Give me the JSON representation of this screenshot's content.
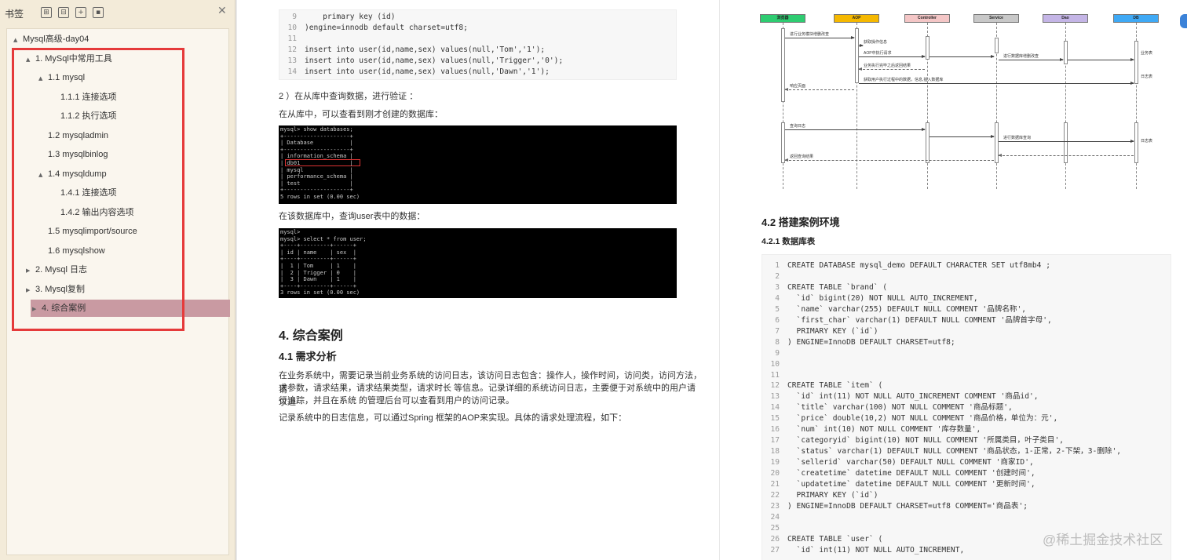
{
  "sidebar": {
    "title": "书签",
    "toolbar_icons": [
      "expand-all-icon",
      "collapse-all-icon",
      "add-bookmark-icon",
      "bookmark-icon"
    ],
    "toc": [
      {
        "label": "Mysql高级-day04",
        "level": 0,
        "twisty": "▲"
      },
      {
        "label": "1. MySql中常用工具",
        "level": 1,
        "twisty": "▲"
      },
      {
        "label": "1.1 mysql",
        "level": 2,
        "twisty": "▲"
      },
      {
        "label": "1.1.1 连接选项",
        "level": 3,
        "twisty": ""
      },
      {
        "label": "1.1.2 执行选项",
        "level": 3,
        "twisty": ""
      },
      {
        "label": "1.2 mysqladmin",
        "level": 2,
        "twisty": ""
      },
      {
        "label": "1.3 mysqlbinlog",
        "level": 2,
        "twisty": ""
      },
      {
        "label": "1.4 mysqldump",
        "level": 2,
        "twisty": "▲"
      },
      {
        "label": "1.4.1 连接选项",
        "level": 3,
        "twisty": ""
      },
      {
        "label": "1.4.2 输出内容选项",
        "level": 3,
        "twisty": ""
      },
      {
        "label": "1.5 mysqlimport/source",
        "level": 2,
        "twisty": ""
      },
      {
        "label": "1.6 mysqlshow",
        "level": 2,
        "twisty": ""
      },
      {
        "label": "2. Mysql 日志",
        "level": 1,
        "twisty": "▶"
      },
      {
        "label": "3. Mysql复制",
        "level": 1,
        "twisty": "▶"
      },
      {
        "label": "4. 综合案例",
        "level": 1,
        "twisty": "▶",
        "active": true
      }
    ]
  },
  "page1": {
    "code_top": [
      {
        "n": "9",
        "t": "    primary key (id)"
      },
      {
        "n": "10",
        "t": ")engine=innodb default charset=utf8;"
      },
      {
        "n": "11",
        "t": ""
      },
      {
        "n": "12",
        "t": "insert into user(id,name,sex) values(null,'Tom','1');"
      },
      {
        "n": "13",
        "t": "insert into user(id,name,sex) values(null,'Trigger','0');"
      },
      {
        "n": "14",
        "t": "insert into user(id,name,sex) values(null,'Dawn','1');"
      }
    ],
    "step2": "2 ）在从库中查询数据，进行验证 ：",
    "step2_desc": "在从库中，可以查看到刚才创建的数据库：",
    "term1": [
      "mysql> show databases;",
      "+--------------------+",
      "| Database           |",
      "+--------------------+",
      "| information_schema |",
      "| db01               |",
      "| mysql              |",
      "| performance_schema |",
      "| test               |",
      "+--------------------+",
      "5 rows in set (0.00 sec)"
    ],
    "term2_desc": "在该数据库中，查询user表中的数据：",
    "term2": [
      "mysql>",
      "mysql> select * from user;",
      "+----+---------+------+",
      "| id | name    | sex  |",
      "+----+---------+------+",
      "|  1 | Tom     | 1    |",
      "|  2 | Trigger | 0    |",
      "|  3 | Dawn    | 1    |",
      "+----+---------+------+",
      "3 rows in set (0.00 sec)"
    ],
    "h2": "4. 综合案例",
    "h3": "4.1 需求分析",
    "para1_lines": [
      "在业务系统中，需要记录当前业务系统的访问日志，该访问日志包含：操作人，操作时间，访问类，访问方法，请",
      "求参数，请求结果，请求结果类型，请求时长 等信息。记录详细的系统访问日志，主要便于对系统中的用户请求进",
      "行追踪，并且在系统 的管理后台可以查看到用户的访问记录。"
    ],
    "para2": "记录系统中的日志信息，可以通过Spring 框架的AOP来实现。具体的请求处理流程，如下："
  },
  "page2": {
    "seq": {
      "heads": [
        {
          "label": "浏览器",
          "color": "#2ecc71"
        },
        {
          "label": "AOP",
          "color": "#f5b800"
        },
        {
          "label": "Controller",
          "color": "#f4c6c6"
        },
        {
          "label": "Service",
          "color": "#c8c8c8"
        },
        {
          "label": "Dao",
          "color": "#c4b5e6"
        },
        {
          "label": "DB",
          "color": "#3fa9f5"
        }
      ],
      "labels": [
        "进行业务模块增删改查",
        "获取操作信息",
        "AOP中执行请求",
        "业务执行完毕之后返回结果",
        "进行数据库增删改查",
        "业务表",
        "获取用户执行过程中的数据，信息,插入数据库",
        "日志表",
        "响应页面",
        "查询日志",
        "进行数据库查询",
        "日志表",
        "返回查询结果"
      ]
    },
    "h3": "4.2 搭建案例环境",
    "h4": "4.2.1 数据库表",
    "code": [
      {
        "n": "1",
        "t": "CREATE DATABASE mysql_demo DEFAULT CHARACTER SET utf8mb4 ;"
      },
      {
        "n": "2",
        "t": ""
      },
      {
        "n": "3",
        "t": "CREATE TABLE `brand` ("
      },
      {
        "n": "4",
        "t": "  `id` bigint(20) NOT NULL AUTO_INCREMENT,"
      },
      {
        "n": "5",
        "t": "  `name` varchar(255) DEFAULT NULL COMMENT '品牌名称',"
      },
      {
        "n": "6",
        "t": "  `first_char` varchar(1) DEFAULT NULL COMMENT '品牌首字母',"
      },
      {
        "n": "7",
        "t": "  PRIMARY KEY (`id`)"
      },
      {
        "n": "8",
        "t": ") ENGINE=InnoDB DEFAULT CHARSET=utf8;"
      },
      {
        "n": "9",
        "t": ""
      },
      {
        "n": "10",
        "t": ""
      },
      {
        "n": "11",
        "t": ""
      },
      {
        "n": "12",
        "t": "CREATE TABLE `item` ("
      },
      {
        "n": "13",
        "t": "  `id` int(11) NOT NULL AUTO_INCREMENT COMMENT '商品id',"
      },
      {
        "n": "14",
        "t": "  `title` varchar(100) NOT NULL COMMENT '商品标题',"
      },
      {
        "n": "15",
        "t": "  `price` double(10,2) NOT NULL COMMENT '商品价格，单位为：元',"
      },
      {
        "n": "16",
        "t": "  `num` int(10) NOT NULL COMMENT '库存数量',"
      },
      {
        "n": "17",
        "t": "  `categoryid` bigint(10) NOT NULL COMMENT '所属类目，叶子类目',"
      },
      {
        "n": "18",
        "t": "  `status` varchar(1) DEFAULT NULL COMMENT '商品状态，1-正常，2-下架，3-删除',"
      },
      {
        "n": "19",
        "t": "  `sellerid` varchar(50) DEFAULT NULL COMMENT '商家ID',"
      },
      {
        "n": "20",
        "t": "  `createtime` datetime DEFAULT NULL COMMENT '创建时间',"
      },
      {
        "n": "21",
        "t": "  `updatetime` datetime DEFAULT NULL COMMENT '更新时间',"
      },
      {
        "n": "22",
        "t": "  PRIMARY KEY (`id`)"
      },
      {
        "n": "23",
        "t": ") ENGINE=InnoDB DEFAULT CHARSET=utf8 COMMENT='商品表';"
      },
      {
        "n": "24",
        "t": ""
      },
      {
        "n": "25",
        "t": ""
      },
      {
        "n": "26",
        "t": "CREATE TABLE `user` ("
      },
      {
        "n": "27",
        "t": "  `id` int(11) NOT NULL AUTO_INCREMENT,"
      }
    ]
  },
  "watermark": "@稀土掘金技术社区"
}
